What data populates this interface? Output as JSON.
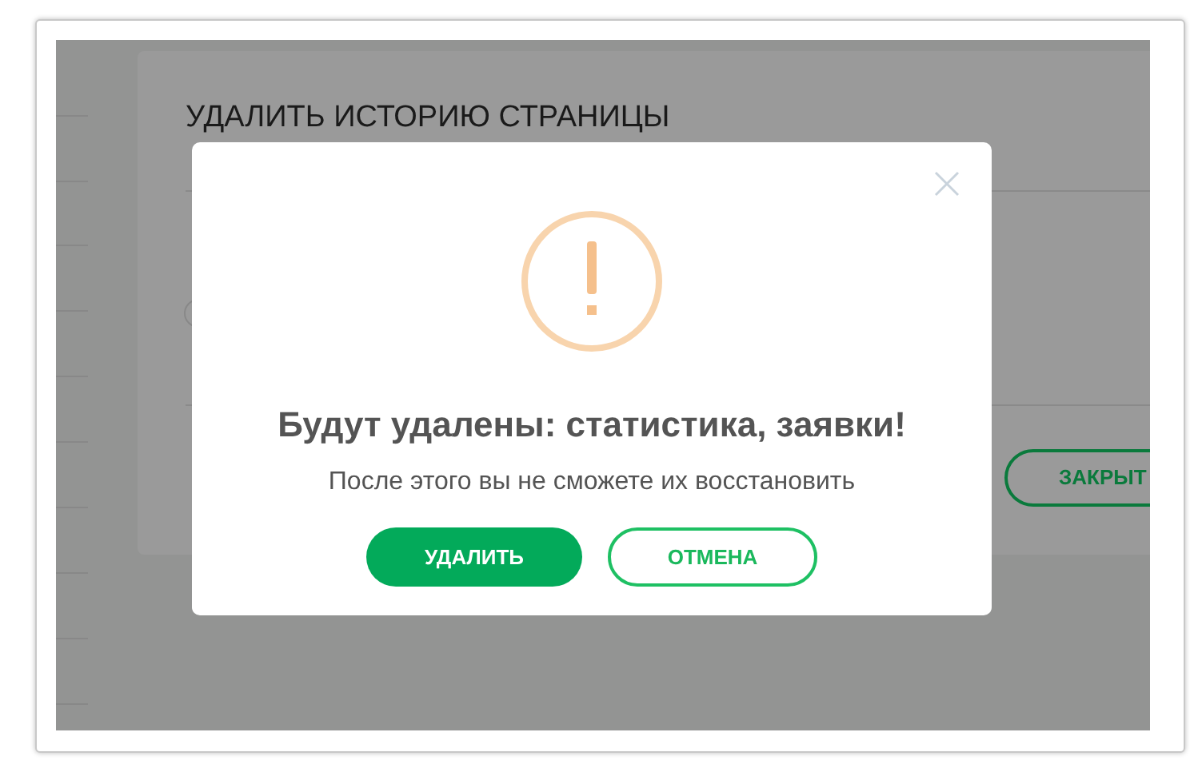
{
  "page": {
    "title": "УДАЛИТЬ ИСТОРИЮ СТРАНИЦЫ",
    "close_button": "ЗАКРЫТ"
  },
  "dialog": {
    "title": "Будут удалены: статистика, заявки!",
    "message": "После этого вы не сможете их восстановить",
    "buttons": [
      {
        "label": "УДАЛИТЬ",
        "kind": "primary"
      },
      {
        "label": "ОТМЕНА",
        "kind": "outline"
      }
    ]
  }
}
